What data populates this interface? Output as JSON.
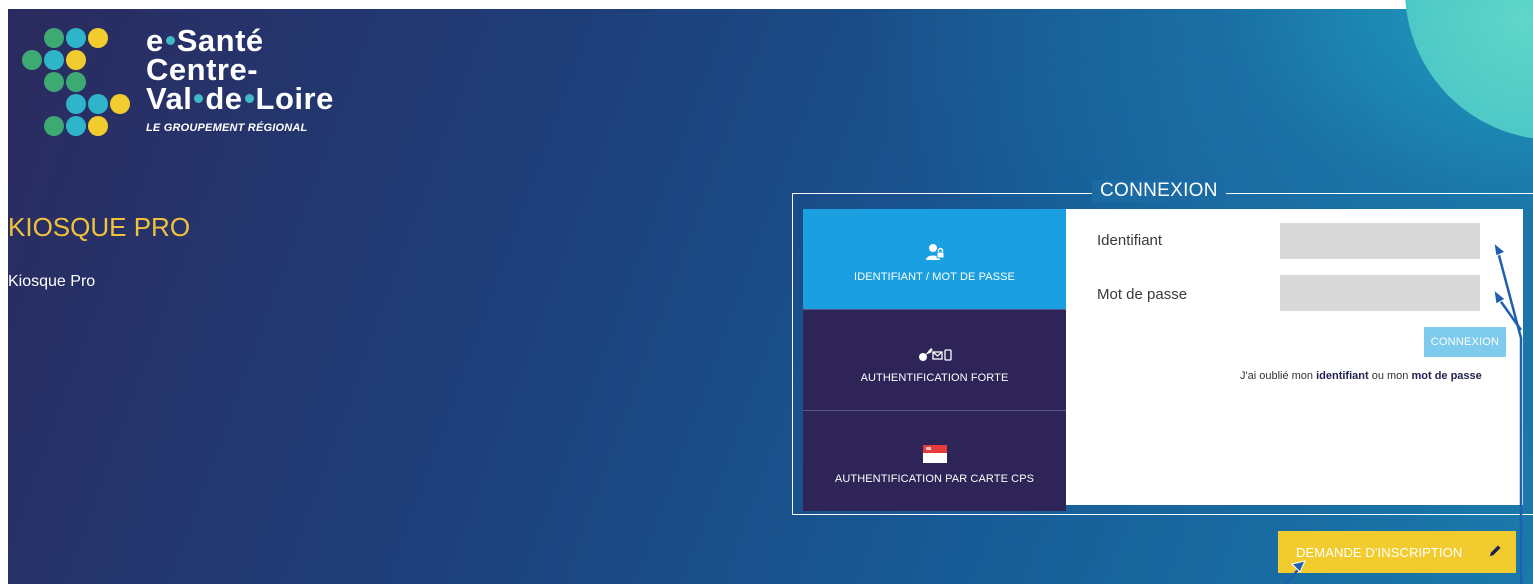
{
  "brand": {
    "logo_prefix": "e",
    "logo_word1": "Santé",
    "logo_line2": "Centre-",
    "logo_line3_a": "Val",
    "logo_line3_b": "de",
    "logo_line3_c": "Loire",
    "subtitle": "LE GROUPEMENT RÉGIONAL",
    "dot_colors": [
      "#2fb5c9",
      "#3daa74",
      "#f2cb2e"
    ]
  },
  "page": {
    "title": "KIOSQUE PRO",
    "subtitle": "Kiosque Pro"
  },
  "login": {
    "legend": "CONNEXION",
    "tabs": [
      {
        "label": "IDENTIFIANT / MOT DE PASSE",
        "icon": "user-lock-icon",
        "active": true
      },
      {
        "label": "AUTHENTIFICATION FORTE",
        "icon": "key-mail-phone-icon",
        "active": false
      },
      {
        "label": "AUTHENTIFICATION PAR CARTE CPS",
        "icon": "cps-card-icon",
        "active": false
      }
    ],
    "identifiant_label": "Identifiant",
    "identifiant_value": "",
    "password_label": "Mot de passe",
    "password_value": "",
    "submit_label": "CONNEXION",
    "forgot_prefix": "J'ai oublié mon ",
    "forgot_identifiant": "identifiant",
    "forgot_middle": " ou mon ",
    "forgot_password": "mot de passe"
  },
  "register": {
    "label": "DEMANDE D'INSCRIPTION",
    "icon": "pencil-icon"
  },
  "colors": {
    "accent_yellow": "#f2cb2e",
    "active_tab": "#1aa0e0",
    "inactive_tab": "#2e2458",
    "annotation": "#1e5fb0"
  }
}
